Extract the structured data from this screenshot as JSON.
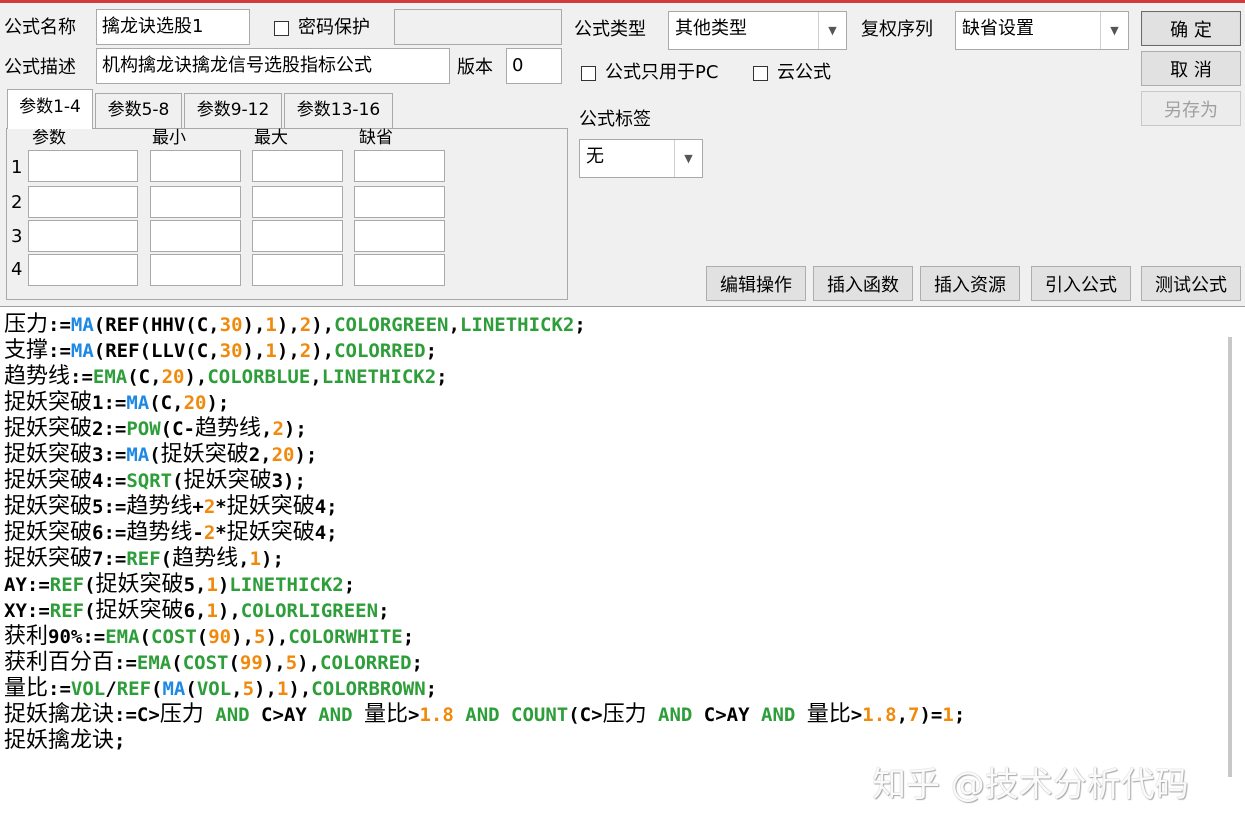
{
  "colors": {
    "accent_red": "#d23b3b",
    "func_blue": "#1e88e5",
    "color_green": "#2e9e3a",
    "number_orange": "#f08a0c"
  },
  "form": {
    "name_label": "公式名称",
    "name_value": "擒龙诀选股1",
    "password_label": "密码保护",
    "desc_label": "公式描述",
    "desc_value": "机构擒龙诀擒龙信号选股指标公式",
    "version_label": "版本",
    "version_value": "0",
    "type_label": "公式类型",
    "type_value": "其他类型",
    "fuquan_label": "复权序列",
    "fuquan_value": "缺省设置",
    "pc_only_label": "公式只用于PC",
    "cloud_label": "云公式",
    "tag_label": "公式标签",
    "tag_value": "无"
  },
  "buttons": {
    "ok": "确 定",
    "cancel": "取 消",
    "save_as": "另存为"
  },
  "tabs": [
    "参数1-4",
    "参数5-8",
    "参数9-12",
    "参数13-16"
  ],
  "params": {
    "headers": [
      "参数",
      "最小",
      "最大",
      "缺省"
    ],
    "rows": [
      "1",
      "2",
      "3",
      "4"
    ]
  },
  "actions": [
    "编辑操作",
    "插入函数",
    "插入资源",
    "引入公式",
    "测试公式"
  ],
  "code_lines": [
    [
      [
        "压力",
        "c"
      ],
      [
        ":=",
        ""
      ],
      [
        "MA",
        "b"
      ],
      [
        "(REF(HHV(C,",
        ""
      ],
      [
        "30",
        "o"
      ],
      [
        "),",
        ""
      ],
      [
        "1",
        "o"
      ],
      [
        "),",
        ""
      ],
      [
        "2",
        "o"
      ],
      [
        "),",
        ""
      ],
      [
        "COLORGREEN",
        "g"
      ],
      [
        ",",
        ""
      ],
      [
        "LINETHICK2",
        "g"
      ],
      [
        ";",
        ""
      ]
    ],
    [
      [
        "支撑",
        "c"
      ],
      [
        ":=",
        ""
      ],
      [
        "MA",
        "b"
      ],
      [
        "(REF(LLV(C,",
        ""
      ],
      [
        "30",
        "o"
      ],
      [
        "),",
        ""
      ],
      [
        "1",
        "o"
      ],
      [
        "),",
        ""
      ],
      [
        "2",
        "o"
      ],
      [
        "),",
        ""
      ],
      [
        "COLORRED",
        "g"
      ],
      [
        ";",
        ""
      ]
    ],
    [
      [
        "趋势线",
        "c"
      ],
      [
        ":=",
        ""
      ],
      [
        "EMA",
        "g"
      ],
      [
        "(C,",
        ""
      ],
      [
        "20",
        "o"
      ],
      [
        "),",
        ""
      ],
      [
        "COLORBLUE",
        "g"
      ],
      [
        ",",
        ""
      ],
      [
        "LINETHICK2",
        "g"
      ],
      [
        ";",
        ""
      ]
    ],
    [
      [
        "捉妖突破",
        "c"
      ],
      [
        "1:=",
        ""
      ],
      [
        "MA",
        "b"
      ],
      [
        "(C,",
        ""
      ],
      [
        "20",
        "o"
      ],
      [
        ");",
        ""
      ]
    ],
    [
      [
        "捉妖突破",
        "c"
      ],
      [
        "2:=",
        ""
      ],
      [
        "POW",
        "g"
      ],
      [
        "(C-",
        ""
      ],
      [
        "趋势线",
        "c"
      ],
      [
        ",",
        ""
      ],
      [
        "2",
        "o"
      ],
      [
        ");",
        ""
      ]
    ],
    [
      [
        "捉妖突破",
        "c"
      ],
      [
        "3:=",
        ""
      ],
      [
        "MA",
        "b"
      ],
      [
        "(",
        ""
      ],
      [
        "捉妖突破",
        "c"
      ],
      [
        "2,",
        ""
      ],
      [
        "20",
        "o"
      ],
      [
        ");",
        ""
      ]
    ],
    [
      [
        "捉妖突破",
        "c"
      ],
      [
        "4:=",
        ""
      ],
      [
        "SQRT",
        "g"
      ],
      [
        "(",
        ""
      ],
      [
        "捉妖突破",
        "c"
      ],
      [
        "3);",
        ""
      ]
    ],
    [
      [
        "捉妖突破",
        "c"
      ],
      [
        "5:=",
        ""
      ],
      [
        "趋势线",
        "c"
      ],
      [
        "+",
        ""
      ],
      [
        "2",
        "o"
      ],
      [
        "*",
        ""
      ],
      [
        "捉妖突破",
        "c"
      ],
      [
        "4;",
        ""
      ]
    ],
    [
      [
        "捉妖突破",
        "c"
      ],
      [
        "6:=",
        ""
      ],
      [
        "趋势线",
        "c"
      ],
      [
        "-",
        ""
      ],
      [
        "2",
        "o"
      ],
      [
        "*",
        ""
      ],
      [
        "捉妖突破",
        "c"
      ],
      [
        "4;",
        ""
      ]
    ],
    [
      [
        "捉妖突破",
        "c"
      ],
      [
        "7:=",
        ""
      ],
      [
        "REF",
        "g"
      ],
      [
        "(",
        ""
      ],
      [
        "趋势线",
        "c"
      ],
      [
        ",",
        ""
      ],
      [
        "1",
        "o"
      ],
      [
        ");",
        ""
      ]
    ],
    [
      [
        "AY:=",
        ""
      ],
      [
        "REF",
        "g"
      ],
      [
        "(",
        ""
      ],
      [
        "捉妖突破",
        "c"
      ],
      [
        "5,",
        ""
      ],
      [
        "1",
        "o"
      ],
      [
        ")",
        ""
      ],
      [
        "LINETHICK2",
        "g"
      ],
      [
        ";",
        ""
      ]
    ],
    [
      [
        "XY:=",
        ""
      ],
      [
        "REF",
        "g"
      ],
      [
        "(",
        ""
      ],
      [
        "捉妖突破",
        "c"
      ],
      [
        "6,",
        ""
      ],
      [
        "1",
        "o"
      ],
      [
        "),",
        ""
      ],
      [
        "COLORLIGREEN",
        "g"
      ],
      [
        ";",
        ""
      ]
    ],
    [
      [
        "获利",
        "c"
      ],
      [
        "90%:=",
        ""
      ],
      [
        "EMA",
        "g"
      ],
      [
        "(",
        ""
      ],
      [
        "COST",
        "g"
      ],
      [
        "(",
        ""
      ],
      [
        "90",
        "o"
      ],
      [
        "),",
        ""
      ],
      [
        "5",
        "o"
      ],
      [
        "),",
        ""
      ],
      [
        "COLORWHITE",
        "g"
      ],
      [
        ";",
        ""
      ]
    ],
    [
      [
        "获利百分百",
        "c"
      ],
      [
        ":=",
        ""
      ],
      [
        "EMA",
        "g"
      ],
      [
        "(",
        ""
      ],
      [
        "COST",
        "g"
      ],
      [
        "(",
        ""
      ],
      [
        "99",
        "o"
      ],
      [
        "),",
        ""
      ],
      [
        "5",
        "o"
      ],
      [
        "),",
        ""
      ],
      [
        "COLORRED",
        "g"
      ],
      [
        ";",
        ""
      ]
    ],
    [
      [
        "量比",
        "c"
      ],
      [
        ":=",
        ""
      ],
      [
        "VOL",
        "g"
      ],
      [
        "/",
        ""
      ],
      [
        "REF",
        "g"
      ],
      [
        "(",
        ""
      ],
      [
        "MA",
        "b"
      ],
      [
        "(",
        ""
      ],
      [
        "VOL",
        "g"
      ],
      [
        ",",
        ""
      ],
      [
        "5",
        "o"
      ],
      [
        "),",
        ""
      ],
      [
        "1",
        "o"
      ],
      [
        "),",
        ""
      ],
      [
        "COLORBROWN",
        "g"
      ],
      [
        ";",
        ""
      ]
    ],
    [
      [
        "捉妖擒龙诀",
        "c"
      ],
      [
        ":=C>",
        ""
      ],
      [
        "压力",
        "c"
      ],
      [
        " ",
        ""
      ],
      [
        "AND",
        "g"
      ],
      [
        " C>AY ",
        ""
      ],
      [
        "AND",
        "g"
      ],
      [
        " ",
        ""
      ],
      [
        "量比",
        "c"
      ],
      [
        ">",
        ""
      ],
      [
        "1.8",
        "o"
      ],
      [
        " ",
        ""
      ],
      [
        "AND",
        "g"
      ],
      [
        " ",
        ""
      ],
      [
        "COUNT",
        "g"
      ],
      [
        "(C>",
        ""
      ],
      [
        "压力",
        "c"
      ],
      [
        " ",
        ""
      ],
      [
        "AND",
        "g"
      ],
      [
        " C>AY ",
        ""
      ],
      [
        "AND",
        "g"
      ],
      [
        " ",
        ""
      ],
      [
        "量比",
        "c"
      ],
      [
        ">",
        ""
      ],
      [
        "1.8",
        "o"
      ],
      [
        ",",
        ""
      ],
      [
        "7",
        "o"
      ],
      [
        ")=",
        ""
      ],
      [
        "1",
        "o"
      ],
      [
        ";",
        ""
      ]
    ],
    [
      [
        "捉妖擒龙诀",
        "c"
      ],
      [
        ";",
        ""
      ]
    ]
  ],
  "watermark": "知乎 @技术分析代码"
}
